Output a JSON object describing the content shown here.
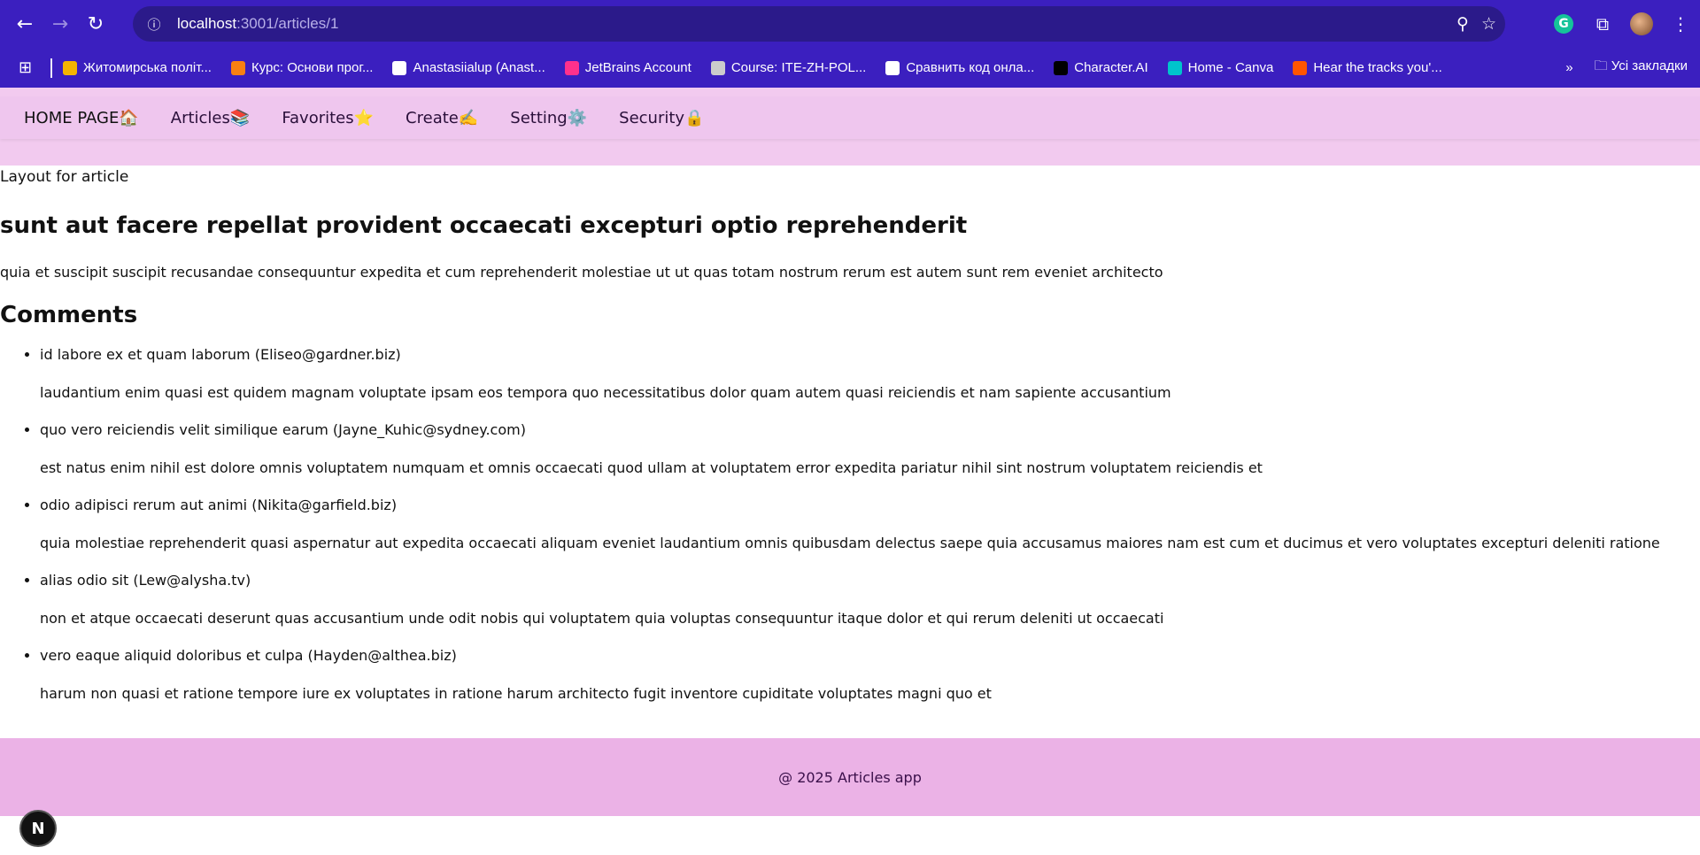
{
  "browser": {
    "url_host": "localhost",
    "url_rest": ":3001/articles/1",
    "back_icon": "←",
    "forward_icon": "→",
    "reload_icon": "↻",
    "bookmarks": [
      {
        "label": "Житомирська політ...",
        "icon": "google-style-icon",
        "color": "#f4b400"
      },
      {
        "label": "Курс: Основи прог...",
        "icon": "moodle-icon",
        "color": "#f98012"
      },
      {
        "label": "Anastasiialup (Anast...",
        "icon": "github-icon",
        "color": "#ffffff"
      },
      {
        "label": "JetBrains Account",
        "icon": "jetbrains-icon",
        "color": "#ff318c"
      },
      {
        "label": "Course: ITE-ZH-POL...",
        "icon": "course-icon",
        "color": "#cccccc"
      },
      {
        "label": "Сравнить код онла...",
        "icon": "compare-icon",
        "color": "#ffffff"
      },
      {
        "label": "Character.AI",
        "icon": "characterai-icon",
        "color": "#000000"
      },
      {
        "label": "Home - Canva",
        "icon": "canva-icon",
        "color": "#00c4cc"
      },
      {
        "label": "Hear the tracks you'...",
        "icon": "soundcloud-icon",
        "color": "#ff5500"
      }
    ],
    "all_bookmarks": "Усі закладки"
  },
  "app": {
    "nav": [
      {
        "label": "HOME PAGE🏠",
        "name": "nav-home"
      },
      {
        "label": "Articles📚",
        "name": "nav-articles"
      },
      {
        "label": "Favorites⭐",
        "name": "nav-favorites"
      },
      {
        "label": "Create✍️",
        "name": "nav-create"
      },
      {
        "label": "Setting⚙️",
        "name": "nav-setting"
      },
      {
        "label": "Security🔒",
        "name": "nav-security"
      }
    ],
    "layout_label": "Layout for article",
    "article": {
      "title": "sunt aut facere repellat provident occaecati excepturi optio reprehenderit",
      "body": "quia et suscipit suscipit recusandae consequuntur expedita et cum reprehenderit molestiae ut ut quas totam nostrum rerum est autem sunt rem eveniet architecto"
    },
    "comments_heading": "Comments",
    "comments": [
      {
        "name": "id labore ex et quam laborum",
        "email": "Eliseo@gardner.biz",
        "body": "laudantium enim quasi est quidem magnam voluptate ipsam eos tempora quo necessitatibus dolor quam autem quasi reiciendis et nam sapiente accusantium"
      },
      {
        "name": "quo vero reiciendis velit similique earum",
        "email": "Jayne_Kuhic@sydney.com",
        "body": "est natus enim nihil est dolore omnis voluptatem numquam et omnis occaecati quod ullam at voluptatem error expedita pariatur nihil sint nostrum voluptatem reiciendis et"
      },
      {
        "name": "odio adipisci rerum aut animi",
        "email": "Nikita@garfield.biz",
        "body": "quia molestiae reprehenderit quasi aspernatur aut expedita occaecati aliquam eveniet laudantium omnis quibusdam delectus saepe quia accusamus maiores nam est cum et ducimus et vero voluptates excepturi deleniti ratione"
      },
      {
        "name": "alias odio sit",
        "email": "Lew@alysha.tv",
        "body": "non et atque occaecati deserunt quas accusantium unde odit nobis qui voluptatem quia voluptas consequuntur itaque dolor et qui rerum deleniti ut occaecati"
      },
      {
        "name": "vero eaque aliquid doloribus et culpa",
        "email": "Hayden@althea.biz",
        "body": "harum non quasi et ratione tempore iure ex voluptates in ratione harum architecto fugit inventore cupiditate voluptates magni quo et"
      }
    ],
    "footer": "@ 2025 Articles app",
    "dev_badge": "N"
  },
  "colors": {
    "browser_chrome": "#3b1fbf",
    "nav_bg": "#efc6ee",
    "footer_bg": "#ebb2e6"
  }
}
